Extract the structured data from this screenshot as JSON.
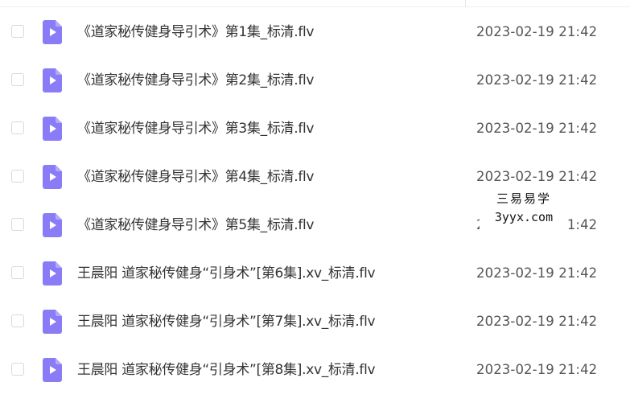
{
  "files": [
    {
      "name": "《道家秘传健身导引术》第1集_标清.flv",
      "date": "2023-02-19 21:42",
      "type_icon": "video-file-icon"
    },
    {
      "name": "《道家秘传健身导引术》第2集_标清.flv",
      "date": "2023-02-19 21:42",
      "type_icon": "video-file-icon"
    },
    {
      "name": "《道家秘传健身导引术》第3集_标清.flv",
      "date": "2023-02-19 21:42",
      "type_icon": "video-file-icon"
    },
    {
      "name": "《道家秘传健身导引术》第4集_标清.flv",
      "date": "2023-02-19 21:42",
      "type_icon": "video-file-icon"
    },
    {
      "name": "《道家秘传健身导引术》第5集_标清.flv",
      "date": "2023-02-19 21:42",
      "type_icon": "video-file-icon"
    },
    {
      "name": "王晨阳 道家秘传健身“引身术”[第6集].xv_标清.flv",
      "date": "2023-02-19 21:42",
      "type_icon": "video-file-icon"
    },
    {
      "name": "王晨阳 道家秘传健身“引身术”[第7集].xv_标清.flv",
      "date": "2023-02-19 21:42",
      "type_icon": "video-file-icon"
    },
    {
      "name": "王晨阳 道家秘传健身“引身术”[第8集].xv_标清.flv",
      "date": "2023-02-19 21:42",
      "type_icon": "video-file-icon"
    }
  ],
  "watermark": {
    "line1": "三易易学",
    "line2": "3yyx.com"
  },
  "colors": {
    "icon_purple": "#8a7cf7",
    "icon_play": "#ffffff",
    "text": "#333333",
    "date_text": "#555555"
  }
}
